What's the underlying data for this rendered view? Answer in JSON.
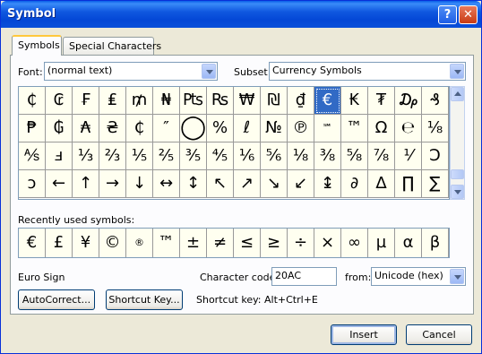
{
  "window": {
    "title": "Symbol",
    "help_glyph": "?",
    "close_glyph": "✕"
  },
  "tabs": [
    {
      "label": "Symbols",
      "active": true
    },
    {
      "label": "Special Characters",
      "active": false
    }
  ],
  "font": {
    "label": "Font:",
    "value": "(normal text)"
  },
  "subset": {
    "label": "Subset:",
    "value": "Currency Symbols"
  },
  "symbols": {
    "selected_index": 11,
    "rows": [
      [
        "₵",
        "₢",
        "₣",
        "₤",
        "₥",
        "₦",
        "₧",
        "₨",
        "₩",
        "₪",
        "₫",
        "€",
        "₭",
        "₮",
        "₯",
        "₰"
      ],
      [
        "₱",
        "₲",
        "₳",
        "₴",
        "₵",
        "″",
        "◯",
        "%",
        "ℓ",
        "№",
        "℗",
        "℠",
        "™",
        "Ω",
        "℮",
        "⅛"
      ],
      [
        "⅍",
        "ⅎ",
        "⅓",
        "⅔",
        "⅕",
        "⅖",
        "⅗",
        "⅘",
        "⅙",
        "⅚",
        "⅛",
        "⅜",
        "⅝",
        "⅞",
        "⅟",
        "Ↄ"
      ],
      [
        "ↄ",
        "←",
        "↑",
        "→",
        "↓",
        "↔",
        "↕",
        "↖",
        "↗",
        "↘",
        "↙",
        "↨",
        "∂",
        "∆",
        "∏",
        "∑"
      ]
    ]
  },
  "recent": {
    "label": "Recently used symbols:",
    "items": [
      "€",
      "£",
      "¥",
      "©",
      "®",
      "™",
      "±",
      "≠",
      "≤",
      "≥",
      "÷",
      "×",
      "∞",
      "µ",
      "α",
      "β"
    ]
  },
  "character_name": "Euro Sign",
  "character_code": {
    "label": "Character code:",
    "value": "20AC"
  },
  "from": {
    "label": "from:",
    "value": "Unicode (hex)"
  },
  "buttons": {
    "autocorrect": "AutoCorrect...",
    "shortcut_key": "Shortcut Key...",
    "insert": "Insert",
    "cancel": "Cancel"
  },
  "shortcut_text": "Shortcut key: Alt+Ctrl+E",
  "colors": {
    "titlebar": "#0a5ee8",
    "selected_cell": "#316ac5",
    "cell_bg": "#fffff0"
  }
}
